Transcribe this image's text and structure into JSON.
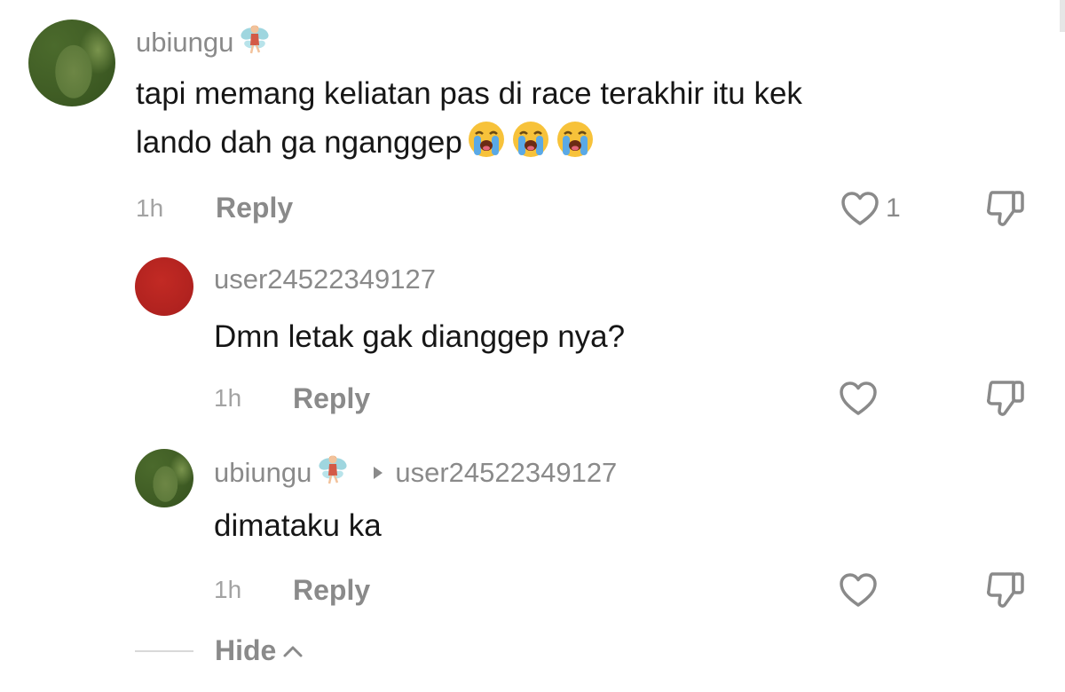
{
  "comments": [
    {
      "username": "ubiungu",
      "username_emoji": "fairy",
      "text_line1": "tapi memang keliatan pas di race terakhir itu kek",
      "text_line2": "lando dah ga nganggep",
      "text_emojis": [
        "loudly-crying-face",
        "loudly-crying-face",
        "loudly-crying-face"
      ],
      "time": "1h",
      "reply_label": "Reply",
      "like_count": "1"
    }
  ],
  "replies": [
    {
      "username": "user24522349127",
      "text": "Dmn letak gak dianggep nya?",
      "time": "1h",
      "reply_label": "Reply"
    },
    {
      "username": "ubiungu",
      "username_emoji": "fairy",
      "reply_to": "user24522349127",
      "text": "dimataku ka",
      "time": "1h",
      "reply_label": "Reply"
    }
  ],
  "hide_label": "Hide",
  "colors": {
    "secondary_text": "#8a8a8a",
    "primary_text": "#161616",
    "avatar_red": "#b0221f",
    "avatar_green": "#4b6a2c"
  },
  "icons": [
    "heart-outline-icon",
    "thumbs-down-icon",
    "chevron-up-icon",
    "caret-right-icon",
    "fairy-emoji",
    "loudly-crying-face-emoji"
  ]
}
